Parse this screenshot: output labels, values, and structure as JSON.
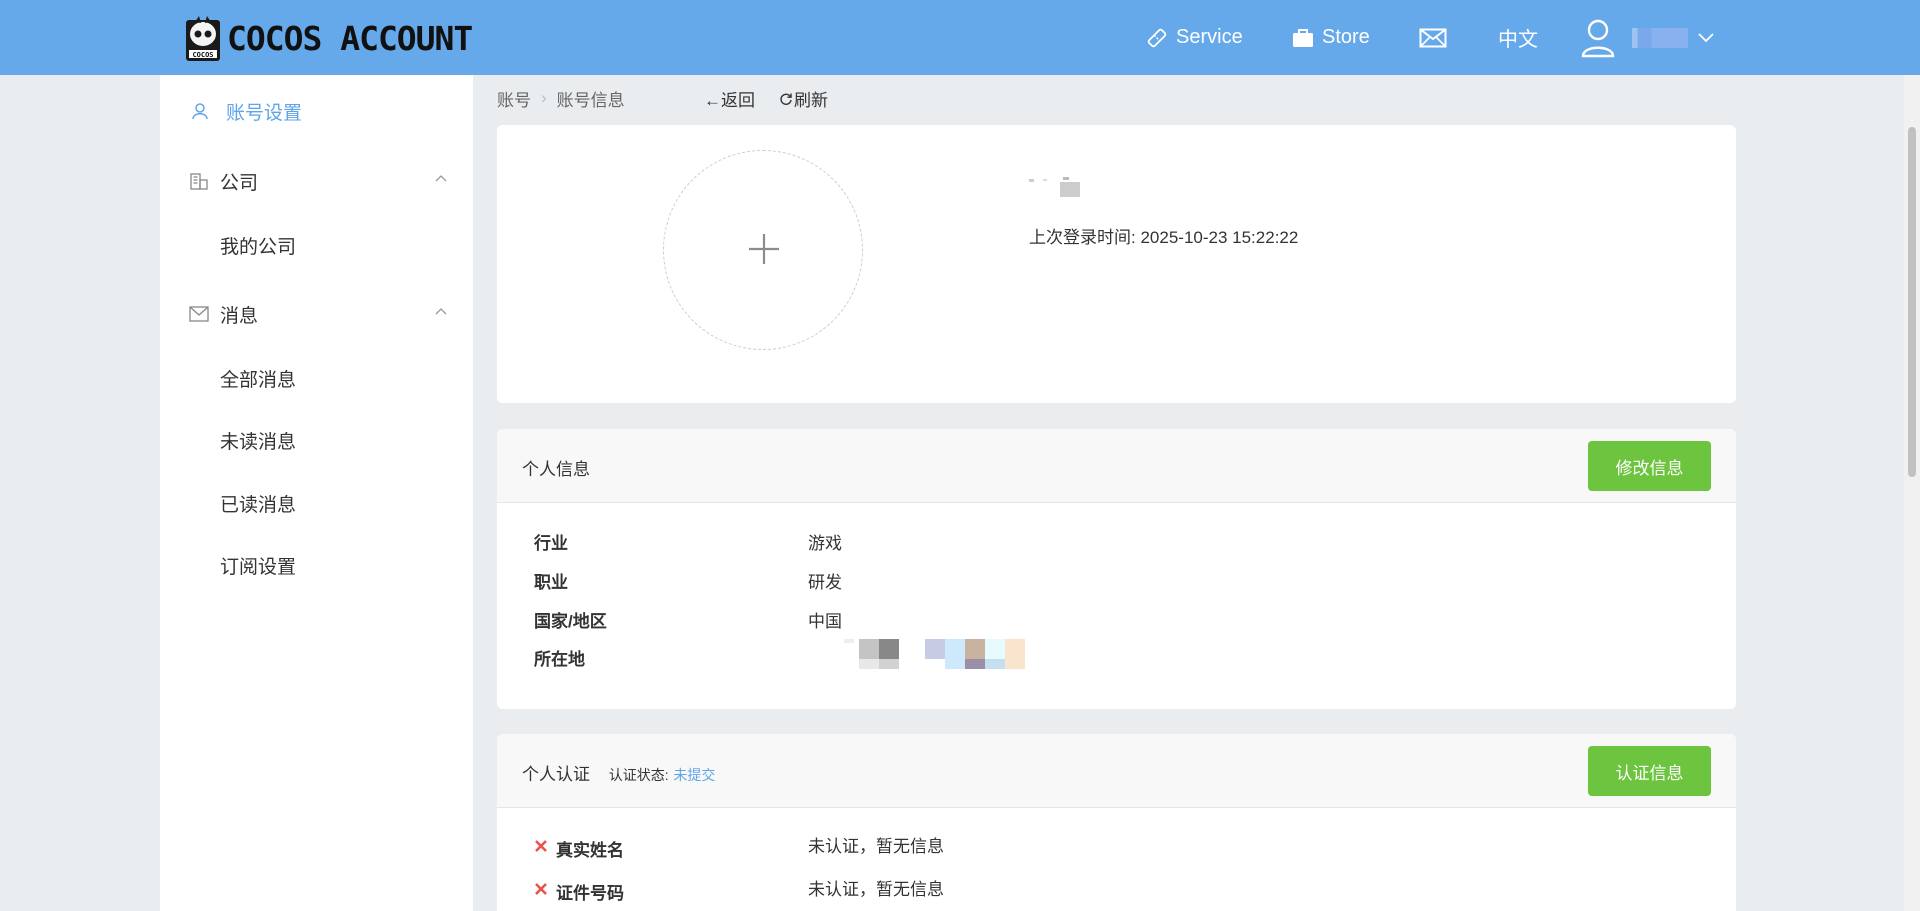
{
  "header": {
    "brand": "COCOS ACCOUNT",
    "nav": {
      "service": "Service",
      "store": "Store",
      "language": "中文"
    }
  },
  "sidebar": {
    "account_settings": "账号设置",
    "company": {
      "label": "公司",
      "items": [
        "我的公司"
      ]
    },
    "messages": {
      "label": "消息",
      "items": [
        "全部消息",
        "未读消息",
        "已读消息",
        "订阅设置"
      ]
    }
  },
  "breadcrumb": {
    "items": [
      "账号",
      "账号信息"
    ],
    "back": "←返回",
    "refresh": "刷新"
  },
  "profile": {
    "last_login_label": "上次登录时间:",
    "last_login_value": "2025-10-23 15:22:22"
  },
  "personal_info": {
    "title": "个人信息",
    "edit_button": "修改信息",
    "rows": [
      {
        "key": "行业",
        "value": "游戏"
      },
      {
        "key": "职业",
        "value": "研发"
      },
      {
        "key": "国家/地区",
        "value": "中国"
      },
      {
        "key": "所在地",
        "value": ""
      }
    ]
  },
  "verification": {
    "title": "个人认证",
    "status_label": "认证状态:",
    "status_value": "未提交",
    "button": "认证信息",
    "rows": [
      {
        "key": "真实姓名",
        "value": "未认证，暂无信息"
      },
      {
        "key": "证件号码",
        "value": "未认证，暂无信息"
      }
    ]
  },
  "colors": {
    "header_bg": "#66a9ea",
    "accent": "#5ea4ea",
    "button_green": "#6cc43f",
    "error_red": "#e8534a"
  }
}
